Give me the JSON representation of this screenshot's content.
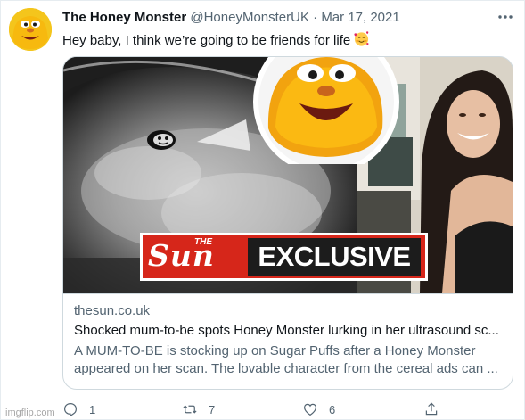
{
  "tweet": {
    "display_name": "The Honey Monster",
    "handle": "@HoneyMonsterUK",
    "separator": "·",
    "date": "Mar 17, 2021",
    "text": "Hey baby, I think we’re going to be friends for life",
    "emoji": "smiling-face-with-hearts"
  },
  "card": {
    "banner_the": "THE",
    "banner_sun": "Sun",
    "banner_exclusive": "EXCLUSIVE",
    "domain": "thesun.co.uk",
    "title": "Shocked mum-to-be spots Honey Monster lurking in her ultrasound sc...",
    "description_line1": "A MUM-TO-BE is stocking up on Sugar Puffs after a Honey Monster",
    "description_line2": "appeared on her scan. The lovable character from the cereal ads can ..."
  },
  "actions": {
    "replies": "1",
    "retweets": "7",
    "likes": "6"
  },
  "watermark": "imgflip.com",
  "colors": {
    "text_primary": "#0f1419",
    "text_secondary": "#536471",
    "border": "#cfd9de",
    "sun_red": "#d6261a"
  }
}
